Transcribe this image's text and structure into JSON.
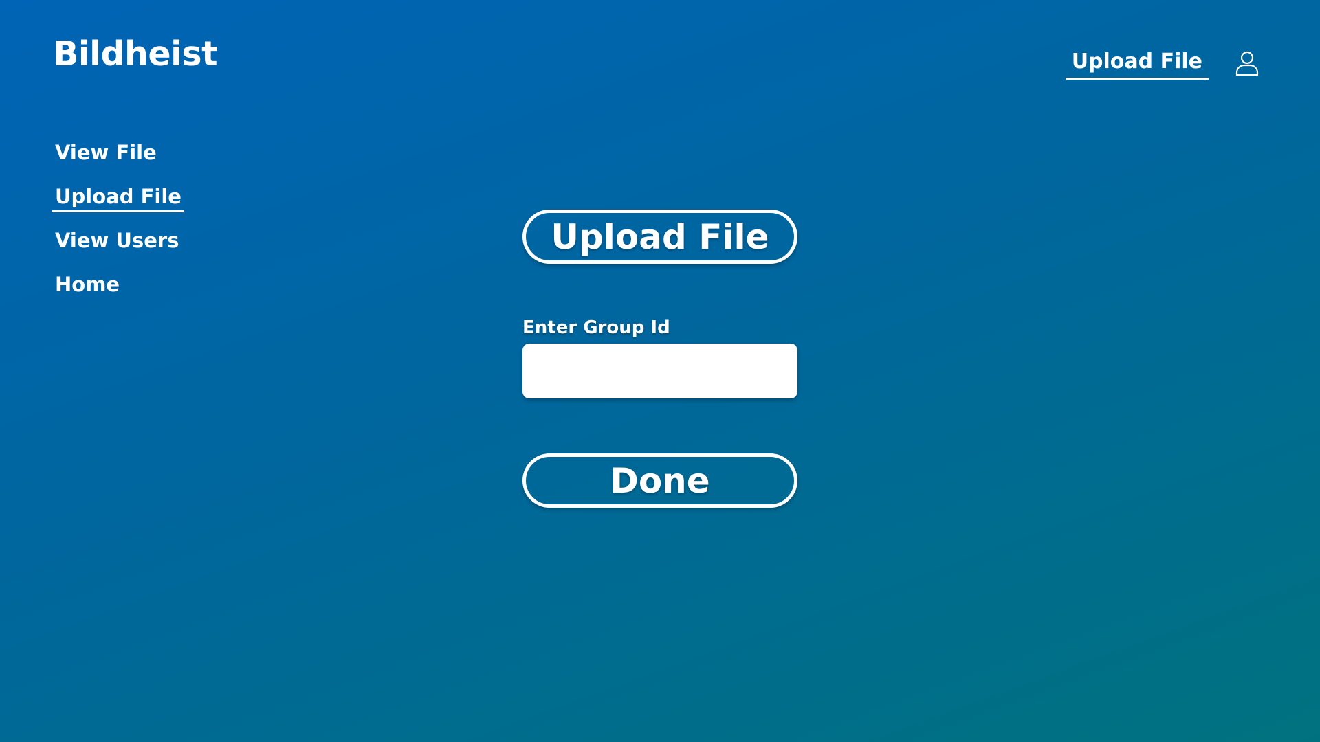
{
  "app": {
    "title": "Bildheist"
  },
  "header": {
    "active_link": "Upload File",
    "user_icon": "user-icon"
  },
  "sidebar": {
    "items": [
      {
        "label": "View File"
      },
      {
        "label": "Upload File",
        "active": true
      },
      {
        "label": "View Users"
      },
      {
        "label": "Home"
      }
    ]
  },
  "main": {
    "upload_button_label": "Upload File",
    "group_id": {
      "label": "Enter Group Id",
      "value": "",
      "placeholder": ""
    },
    "done_button_label": "Done"
  },
  "colors": {
    "gradient_start": "#0064b6",
    "gradient_end": "#00727f",
    "text": "#ffffff",
    "input_background": "#ffffff"
  }
}
